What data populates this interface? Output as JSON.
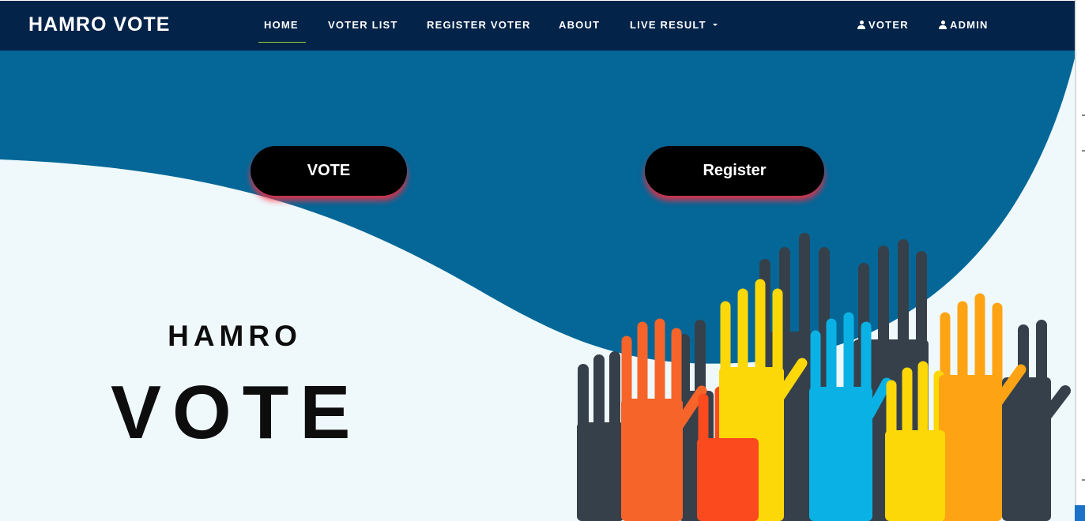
{
  "navbar": {
    "brand": "HAMRO VOTE",
    "items": [
      {
        "label": "HOME",
        "active": true
      },
      {
        "label": "VOTER LIST",
        "active": false
      },
      {
        "label": "REGISTER VOTER",
        "active": false
      },
      {
        "label": "ABOUT",
        "active": false
      },
      {
        "label": "LIVE RESULT",
        "active": false,
        "dropdown": true
      }
    ],
    "right_items": [
      {
        "label": "VOTER",
        "icon": "user-icon"
      },
      {
        "label": "ADMIN",
        "icon": "user-icon"
      }
    ]
  },
  "hero": {
    "vote_button": "VOTE",
    "register_button": "Register",
    "title_small": "HAMRO",
    "title_big": "VOTE"
  },
  "colors": {
    "navbar": "#032349",
    "wave_blue": "#046797",
    "background": "#eff9fc",
    "button": "#000000",
    "button_glow": "#ff283c",
    "active_underline": "#9cd13a",
    "hand_dark": "#36404a",
    "hand_orange": "#f7642a",
    "hand_red": "#fb4a1e",
    "hand_yellow": "#fcd809",
    "hand_cyan": "#0ab1e4",
    "hand_amber": "#fea414"
  }
}
